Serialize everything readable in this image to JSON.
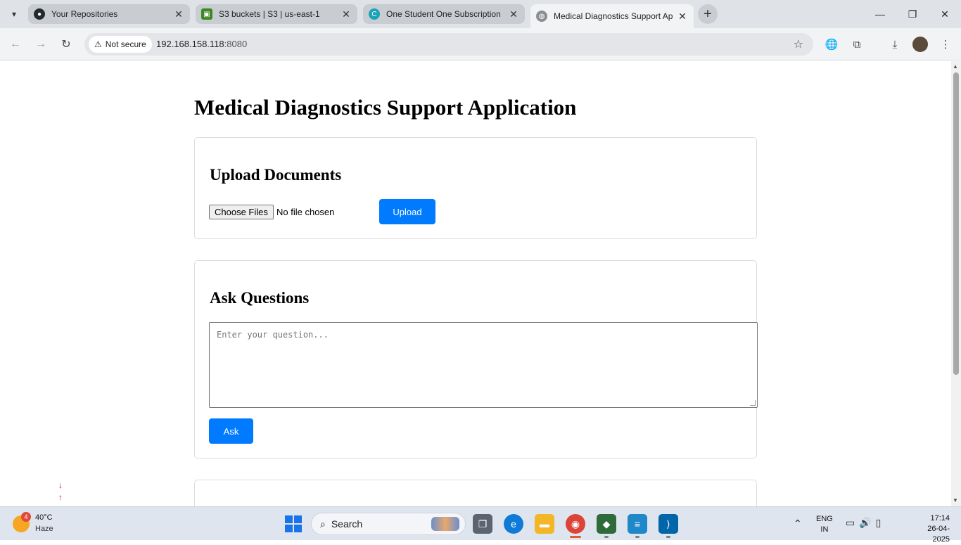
{
  "browser": {
    "tabs": [
      {
        "title": "Your Repositories",
        "active": false,
        "favicon": "github-icon"
      },
      {
        "title": "S3 buckets | S3 | us-east-1",
        "active": false,
        "favicon": "aws-s3-icon"
      },
      {
        "title": "One Student One Subscription |",
        "active": false,
        "favicon": "c-logo-icon"
      },
      {
        "title": "Medical Diagnostics Support Ap",
        "active": true,
        "favicon": "globe-icon"
      }
    ],
    "security_chip": "Not secure",
    "url_host": "192.168.158.118",
    "url_port": ":8080"
  },
  "page": {
    "title": "Medical Diagnostics Support Application",
    "upload": {
      "heading": "Upload Documents",
      "choose_label": "Choose Files",
      "file_status": "No file chosen",
      "upload_label": "Upload"
    },
    "ask": {
      "heading": "Ask Questions",
      "placeholder": "Enter your question...",
      "ask_label": "Ask"
    }
  },
  "taskbar": {
    "weather_badge": "4",
    "temperature": "40°C",
    "condition": "Haze",
    "search_label": "Search",
    "lang_top": "ENG",
    "lang_bottom": "IN",
    "time": "17:14",
    "date": "26-04-2025"
  },
  "colors": {
    "accent": "#007bff",
    "tabstrip": "#dfe3e8",
    "taskbar": "#dfe5ee"
  }
}
